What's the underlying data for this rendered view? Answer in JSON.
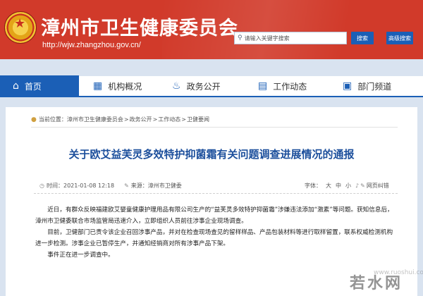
{
  "header": {
    "title": "漳州市卫生健康委员会",
    "url": "http://wjw.zhangzhou.gov.cn/",
    "search_placeholder": "请输入关键字搜索",
    "search_button": "搜索",
    "advanced_search_button": "高级搜索",
    "brand_color": "#d13a2a"
  },
  "nav": {
    "items": [
      {
        "label": "首页",
        "icon": "home-icon"
      },
      {
        "label": "机构概况",
        "icon": "building-icon"
      },
      {
        "label": "政务公开",
        "icon": "bell-icon"
      },
      {
        "label": "工作动态",
        "icon": "chart-icon"
      },
      {
        "label": "部门频道",
        "icon": "monitor-icon"
      }
    ],
    "accent_color": "#1b5fb6"
  },
  "breadcrumb": {
    "prefix": "当前位置：",
    "items": [
      "漳州市卫生健康委员会",
      "政务公开",
      "工作动态",
      "卫健要闻"
    ],
    "separator": ">"
  },
  "article": {
    "title": "关于欧艾益芙灵多效特护抑菌霜有关问题调查进展情况的通报",
    "meta": {
      "time": "时间：2021-01-08 12:18",
      "source": "来源：漳州市卫健委",
      "font_size_label": "字体：",
      "font_large": "大",
      "font_medium": "中",
      "font_small": "小",
      "error_report": "网页纠错"
    },
    "paragraphs": [
      "近日，有群众反映福建欧艾婴童健康护理用品有限公司生产的“益芙灵多效特护抑菌霜”涉嫌违法添加“激素”等问题。获知信息后，漳州市卫健委联合市场监管局迅速介入，立即组织人员前往涉事企业现场调查。",
      "目前，卫健部门已责令该企业召回涉事产品，并对在检查现场查见的留样样品、产品包装材料等进行取样留置，联系权威检测机构进一步检测。涉事企业已暂停生产，并通知经销商对所有涉事产品下架。",
      "事件正在进一步调查中。"
    ]
  },
  "watermark": {
    "main": "若水网",
    "sub": "www.ruoshui.com"
  }
}
